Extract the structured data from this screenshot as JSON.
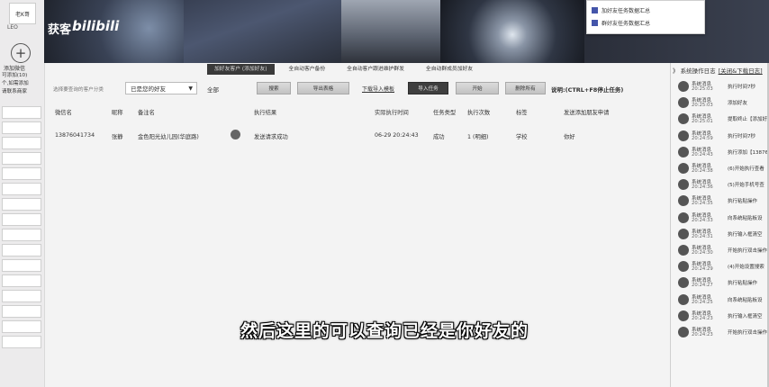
{
  "sidebar": {
    "avatar_text": "老K哥",
    "name": "LEO",
    "add_label": "添加微信",
    "info_lines": [
      "可添加(10)",
      "个,如需添加",
      "请联系商家"
    ]
  },
  "banner": {
    "brand_text": "获客",
    "brand_logo": "bilibili"
  },
  "popup": {
    "items": [
      "加好友任务数据汇总",
      "群好友任务数据汇总"
    ]
  },
  "tabs": [
    "加好友客户 (添加好友)",
    "全自动客户备份",
    "全自动客户跟进维护群发",
    "全自动群成员加好友"
  ],
  "toolbar": {
    "label": "选择要查询的客户分类",
    "select_value": "已是您的好友",
    "all_label": "全部",
    "buttons": [
      "搜索",
      "导出表格"
    ],
    "link": "下载导入模板",
    "import_button": "导入任务",
    "buttons2": [
      "开始",
      "删除所有"
    ],
    "hint": "说明:(CTRL+F8停止任务)"
  },
  "table": {
    "headers": [
      "微信名",
      "昵称",
      "备注名",
      "执行结果",
      "实际执行时间",
      "任务类型",
      "执行次数",
      "标签",
      "发送添加朋友申请"
    ],
    "rows": [
      [
        "13876041734",
        "张静",
        "金色阳光幼儿园(华庭路)",
        "发送请求成功",
        "06-29 20:24:43",
        "成功",
        "1 (明细)",
        "学校",
        "你好"
      ]
    ]
  },
  "log_panel": {
    "title": "》 系统操作日志",
    "link": "[关闭&下载日志]",
    "entries": [
      {
        "name": "系统消息",
        "time": "20:25:03",
        "msg": "执行时间7秒"
      },
      {
        "name": "系统消息",
        "time": "20:25:03",
        "msg": "添加好友"
      },
      {
        "name": "系统消息",
        "time": "20:25:01",
        "msg": "提取终止【添加好友"
      },
      {
        "name": "系统消息",
        "time": "20:24:59",
        "msg": "执行时间7秒"
      },
      {
        "name": "系统消息",
        "time": "20:24:43",
        "msg": "执行添加【13876041"
      },
      {
        "name": "系统消息",
        "time": "20:24:38",
        "msg": "(6)开始执行查看"
      },
      {
        "name": "系统消息",
        "time": "20:24:36",
        "msg": "(5)开始手机号查"
      },
      {
        "name": "系统消息",
        "time": "20:24:35",
        "msg": "执行粘贴操作"
      },
      {
        "name": "系统消息",
        "time": "20:24:33",
        "msg": "向系统粘贴板设"
      },
      {
        "name": "系统消息",
        "time": "20:24:31",
        "msg": "执行输入框清空"
      },
      {
        "name": "系统消息",
        "time": "20:24:30",
        "msg": "开始执行双击操作"
      },
      {
        "name": "系统消息",
        "time": "20:24:29",
        "msg": "(4)开始设置搜索"
      },
      {
        "name": "系统消息",
        "time": "20:24:27",
        "msg": "执行粘贴操作"
      },
      {
        "name": "系统消息",
        "time": "20:24:25",
        "msg": "向系统粘贴板设"
      },
      {
        "name": "系统消息",
        "time": "20:24:23",
        "msg": "执行输入框清空"
      },
      {
        "name": "系统消息",
        "time": "20:24:23",
        "msg": "开始执行双击操作"
      }
    ]
  },
  "subtitle": "然后这里的可以查询已经是你好友的"
}
